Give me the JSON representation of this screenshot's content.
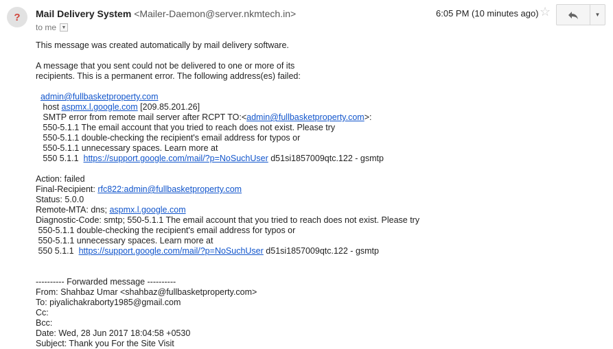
{
  "header": {
    "avatar_glyph": "?",
    "sender_name": "Mail Delivery System",
    "sender_address": "<Mailer-Daemon@server.nkmtech.in>",
    "to_label": "to me",
    "time": "6:05 PM (10 minutes ago)",
    "star_icon": "star-outline-icon",
    "reply_icon": "reply-arrow-icon",
    "more_icon": "caret-down-icon"
  },
  "body": {
    "intro": "This message was created automatically by mail delivery software.",
    "para1_l1": "A message that you sent could not be delivered to one or more of its",
    "para1_l2": "recipients. This is a permanent error. The following address(es) failed:",
    "failed_address": "admin@fullbasketproperty.com",
    "host_prefix": "   host ",
    "host_link": "aspmx.l.google.com",
    "host_ip": " [209.85.201.26]",
    "smtp_prefix": "   SMTP error from remote mail server after RCPT TO:<",
    "smtp_link": "admin@fullbasketproperty.com",
    "smtp_suffix": ">:",
    "err1": "   550-5.1.1 The email account that you tried to reach does not exist. Please try",
    "err2": "   550-5.1.1 double-checking the recipient's email address for typos or",
    "err3": "   550-5.1.1 unnecessary spaces. Learn more at",
    "err4_prefix": "   550 5.1.1  ",
    "err4_link": "https://support.google.com/mail/?p=NoSuchUser",
    "err4_suffix": " d51si1857009qtc.122 - gsmtp",
    "action": "Action: failed",
    "final_prefix": "Final-Recipient: ",
    "final_link": "rfc822:admin@fullbasketproperty.com",
    "status": "Status: 5.0.0",
    "mta_prefix": "Remote-MTA: dns; ",
    "mta_link": "aspmx.l.google.com",
    "diag1": "Diagnostic-Code: smtp; 550-5.1.1 The email account that you tried to reach does not exist. Please try",
    "diag2": " 550-5.1.1 double-checking the recipient's email address for typos or",
    "diag3": " 550-5.1.1 unnecessary spaces. Learn more at",
    "diag4_prefix": " 550 5.1.1  ",
    "diag4_link": "https://support.google.com/mail/?p=NoSuchUser",
    "diag4_suffix": " d51si1857009qtc.122 - gsmtp",
    "fwd_header": "---------- Forwarded message ----------",
    "from": "From: Shahbaz Umar <shahbaz@fullbasketproperty.com>",
    "to": "To: piyalichakraborty1985@gmail.com",
    "cc": "Cc:",
    "bcc": "Bcc:",
    "date": "Date: Wed, 28 Jun 2017 18:04:58 +0530",
    "subject": "Subject: Thank you For the Site Visit"
  }
}
